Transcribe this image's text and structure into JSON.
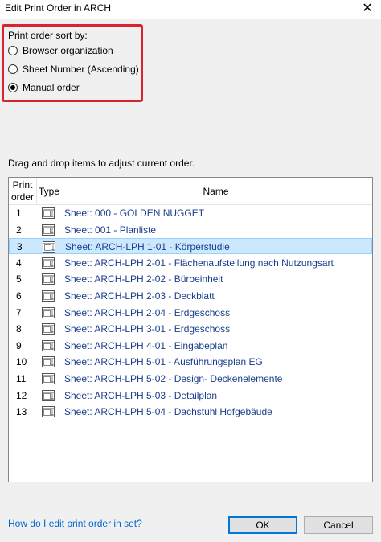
{
  "window": {
    "title": "Edit Print Order in ARCH",
    "close_glyph": "✕"
  },
  "sort": {
    "label": "Print order sort by:",
    "options": [
      {
        "label": "Browser organization",
        "checked": false
      },
      {
        "label": "Sheet Number (Ascending)",
        "checked": false
      },
      {
        "label": "Manual order",
        "checked": true
      }
    ],
    "highlight_color": "#d9232f"
  },
  "hint": "Drag and drop items to adjust current order.",
  "list": {
    "columns": {
      "order_line1": "Print",
      "order_line2": "order",
      "type": "Type",
      "name": "Name"
    },
    "rows": [
      {
        "order": "1",
        "icon": "sheet-icon",
        "name": "Sheet: 000 - GOLDEN NUGGET"
      },
      {
        "order": "2",
        "icon": "sheet-icon",
        "name": "Sheet: 001 - Planliste"
      },
      {
        "order": "3",
        "icon": "sheet-icon",
        "name": "Sheet: ARCH-LPH 1-01 - Körperstudie"
      },
      {
        "order": "4",
        "icon": "sheet-icon",
        "name": "Sheet: ARCH-LPH 2-01 - Flächenaufstellung nach Nutzungsart"
      },
      {
        "order": "5",
        "icon": "sheet-icon",
        "name": "Sheet: ARCH-LPH 2-02 - Büroeinheit"
      },
      {
        "order": "6",
        "icon": "sheet-icon",
        "name": "Sheet: ARCH-LPH 2-03 - Deckblatt"
      },
      {
        "order": "7",
        "icon": "sheet-icon",
        "name": "Sheet: ARCH-LPH 2-04 - Erdgeschoss"
      },
      {
        "order": "8",
        "icon": "sheet-icon",
        "name": "Sheet: ARCH-LPH 3-01 - Erdgeschoss"
      },
      {
        "order": "9",
        "icon": "sheet-icon",
        "name": "Sheet: ARCH-LPH 4-01 - Eingabeplan"
      },
      {
        "order": "10",
        "icon": "sheet-icon",
        "name": "Sheet: ARCH-LPH 5-01 - Ausführungsplan EG"
      },
      {
        "order": "11",
        "icon": "sheet-icon",
        "name": "Sheet: ARCH-LPH 5-02 - Design- Deckenelemente"
      },
      {
        "order": "12",
        "icon": "sheet-icon",
        "name": "Sheet: ARCH-LPH 5-03 - Detailplan"
      },
      {
        "order": "13",
        "icon": "sheet-icon",
        "name": "Sheet: ARCH-LPH 5-04 - Dachstuhl Hofgebäude"
      }
    ],
    "selected_order": "3",
    "selection_color": "#cce8ff",
    "name_color": "#1a3e8c"
  },
  "footer": {
    "help_link": "How do I edit print order in set?",
    "ok_label": "OK",
    "cancel_label": "Cancel"
  }
}
